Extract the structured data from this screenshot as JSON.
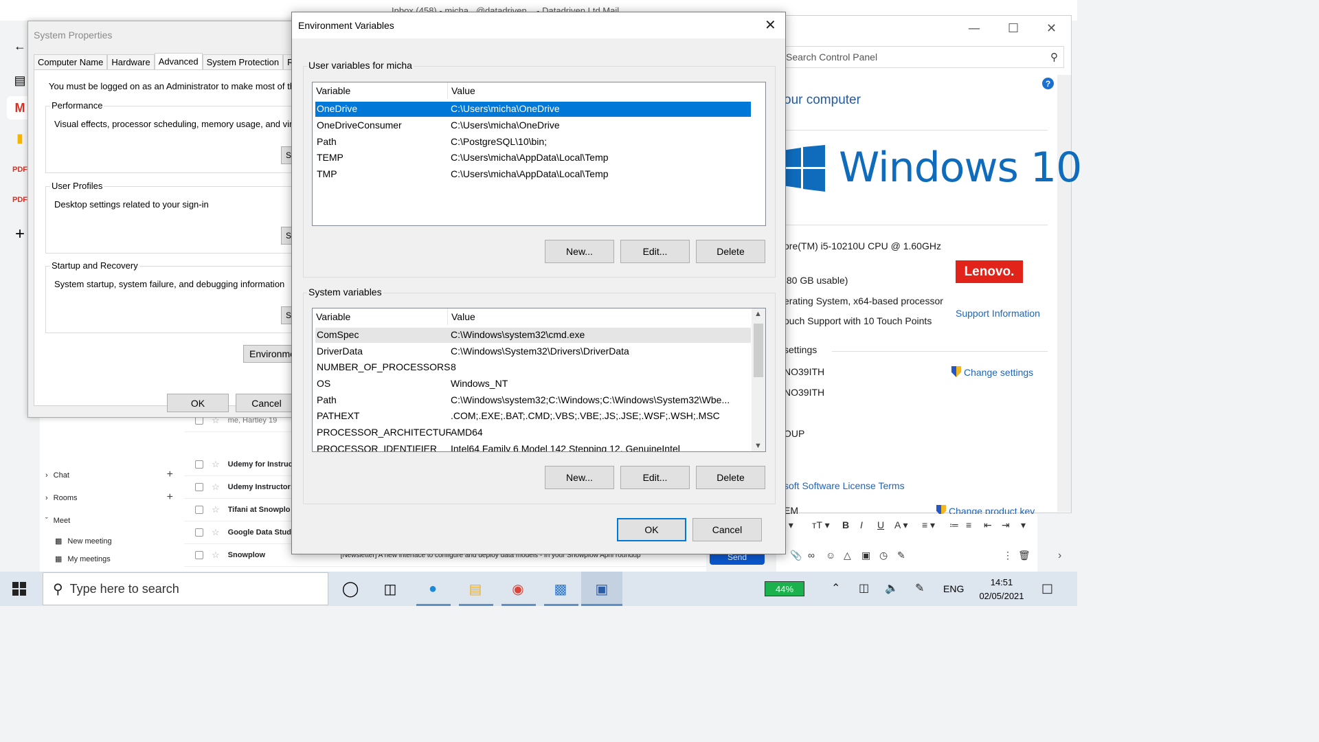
{
  "background": {
    "gmail_title_fragment": "Inbox (458) - micha...@datadriven... - Datadriven Ltd Mail",
    "gmail_nav": {
      "chat": "Chat",
      "rooms": "Rooms",
      "meet": "Meet",
      "new_meeting": "New meeting",
      "my_meetings": "My meetings"
    },
    "mail_rows": [
      {
        "sender": "me, Hartley 19",
        "subject": ""
      },
      {
        "sender": "Udemy for Instruc",
        "subject": ""
      },
      {
        "sender": "Udemy Instructor:",
        "subject": ""
      },
      {
        "sender": "Tifani at Snowplo",
        "subject": ""
      },
      {
        "sender": "Google Data Studi",
        "subject": ""
      },
      {
        "sender": "Snowplow",
        "subject": "[Newsletter] A new interface to configure and deploy data models - In your Snowplow April roundup"
      }
    ],
    "send_label": "Send"
  },
  "control_panel": {
    "search_placeholder": "Search Control Panel",
    "heading": "our computer",
    "windows_brand": "Windows 10",
    "processor": "ore(TM) i5-10210U CPU @ 1.60GHz",
    "ram": ".80 GB usable)",
    "system_type": "erating System, x64-based processor",
    "pen_touch": "ouch Support with 10 Touch Points",
    "lenovo_logo": "Lenovo.",
    "support_info": "Support Information",
    "settings_header": "settings",
    "computer_name": "NO39ITH",
    "full_name": "NO39ITH",
    "change_settings": "Change settings",
    "workgroup": "OUP",
    "license_terms": "soft Software License Terms",
    "product_id": "EM",
    "change_product_key": "Change product key"
  },
  "system_properties": {
    "title": "System Properties",
    "tabs": [
      "Computer Name",
      "Hardware",
      "Advanced",
      "System Protection",
      "Re"
    ],
    "active_tab": "Advanced",
    "admin_note": "You must be logged on as an Administrator to make most of th",
    "performance": {
      "label": "Performance",
      "desc": "Visual effects, processor scheduling, memory usage, and virt"
    },
    "user_profiles": {
      "label": "User Profiles",
      "desc": "Desktop settings related to your sign-in"
    },
    "startup": {
      "label": "Startup and Recovery",
      "desc": "System startup, system failure, and debugging information"
    },
    "stub_button": "S",
    "env_button": "Environmen",
    "ok": "OK",
    "cancel": "Cancel"
  },
  "env_dialog": {
    "title": "Environment Variables",
    "user_section": "User variables for micha",
    "system_section": "System variables",
    "col_variable": "Variable",
    "col_value": "Value",
    "user_vars": [
      {
        "name": "OneDrive",
        "value": "C:\\Users\\micha\\OneDrive"
      },
      {
        "name": "OneDriveConsumer",
        "value": "C:\\Users\\micha\\OneDrive"
      },
      {
        "name": "Path",
        "value": "C:\\PostgreSQL\\10\\bin;"
      },
      {
        "name": "TEMP",
        "value": "C:\\Users\\micha\\AppData\\Local\\Temp"
      },
      {
        "name": "TMP",
        "value": "C:\\Users\\micha\\AppData\\Local\\Temp"
      }
    ],
    "system_vars": [
      {
        "name": "ComSpec",
        "value": "C:\\Windows\\system32\\cmd.exe"
      },
      {
        "name": "DriverData",
        "value": "C:\\Windows\\System32\\Drivers\\DriverData"
      },
      {
        "name": "NUMBER_OF_PROCESSORS",
        "value": "8"
      },
      {
        "name": "OS",
        "value": "Windows_NT"
      },
      {
        "name": "Path",
        "value": "C:\\Windows\\system32;C:\\Windows;C:\\Windows\\System32\\Wbe..."
      },
      {
        "name": "PATHEXT",
        "value": ".COM;.EXE;.BAT;.CMD;.VBS;.VBE;.JS;.JSE;.WSF;.WSH;.MSC"
      },
      {
        "name": "PROCESSOR_ARCHITECTURE",
        "value": "AMD64"
      },
      {
        "name": "PROCESSOR_IDENTIFIER",
        "value": "Intel64 Family 6 Model 142 Stepping 12, GenuineIntel"
      }
    ],
    "new_label": "New...",
    "edit_label": "Edit...",
    "delete_label": "Delete",
    "ok": "OK",
    "cancel": "Cancel"
  },
  "taskbar": {
    "search_placeholder": "Type here to search",
    "battery": "44%",
    "language": "ENG",
    "time": "14:51",
    "date": "02/05/2021"
  }
}
